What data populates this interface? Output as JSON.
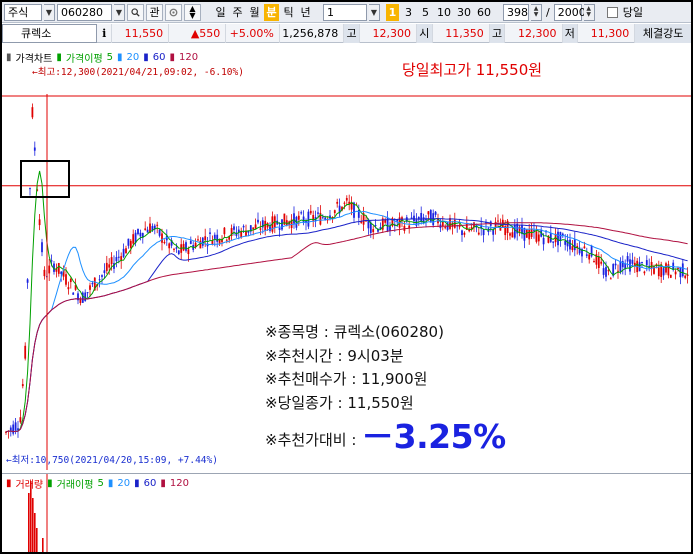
{
  "toolbar": {
    "market": "주식",
    "code": "060280",
    "fav_label": "관",
    "periods": [
      "일",
      "주",
      "월",
      "분",
      "틱",
      "년"
    ],
    "selected_period": "분",
    "interval": "1",
    "minutes": [
      "3",
      "5",
      "10",
      "30",
      "60"
    ],
    "count": "398",
    "slash": "/",
    "total": "2000",
    "today_label": "당일"
  },
  "quote": {
    "name": "큐렉소",
    "info_icon": "i",
    "price": "11,550",
    "change": "▲550",
    "change_pct": "+5.00%",
    "volume": "1,256,878",
    "high_label": "고",
    "high": "12,300",
    "open_label": "시",
    "open": "11,350",
    "high2_label": "고",
    "high2": "12,300",
    "low_label": "저",
    "low": "11,300",
    "strength_label": "체결강도"
  },
  "price_legend": {
    "title": "가격차트",
    "ma_label": "가격이평",
    "ma_periods": [
      "5",
      "20",
      "60",
      "120"
    ],
    "ma_colors": [
      "#00a000",
      "#1e90ff",
      "#1a22c8",
      "#b01040"
    ]
  },
  "volume_legend": {
    "title": "거래량",
    "ma_label": "거래이평",
    "ma_periods": [
      "5",
      "20",
      "60",
      "120"
    ]
  },
  "annotations": {
    "max_label": "←최고:12,300(2021/04/21,09:02, -6.10%)",
    "min_label": "←최저:10,750(2021/04/20,15:09, +7.44%)",
    "day_high": "당일최고가 11,550원"
  },
  "recommendation": {
    "name_line": "※종목명 :  큐렉소(060280)",
    "time_line": "※추천시간 : 9시03분",
    "buy_line": "※추천매수가 : 11,900원",
    "close_line": "※당일종가 : 11,550원",
    "ratio_label": "※추천가대비  :  ",
    "ratio_value": "－3.25%"
  },
  "chart_data": {
    "type": "candlestick",
    "price_range": [
      10750,
      12300
    ],
    "max_price": 12300,
    "min_price": 10750,
    "recommended_buy": 11900,
    "close": 11550
  }
}
